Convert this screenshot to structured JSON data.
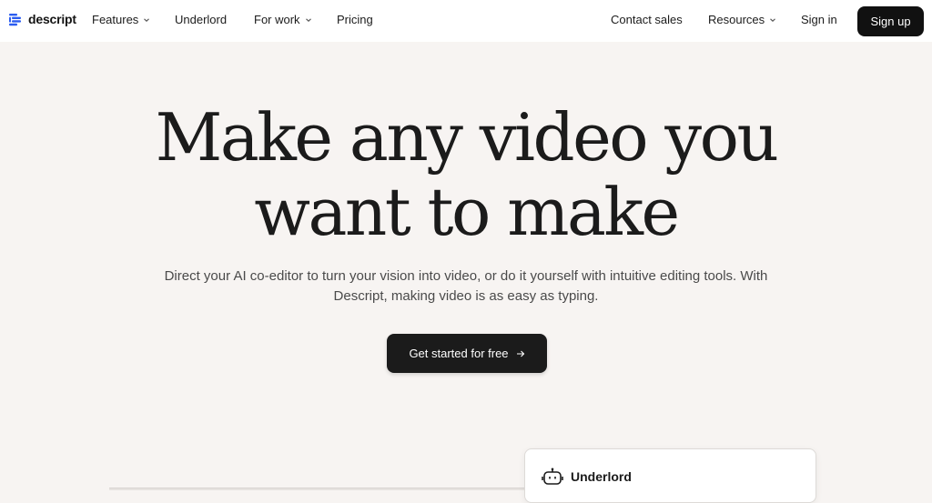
{
  "brand": {
    "name": "descript",
    "accent": "#2b5cf0"
  },
  "nav": {
    "left_items": [
      {
        "label": "Features",
        "has_dropdown": true
      },
      {
        "label": "Underlord",
        "has_dropdown": false
      },
      {
        "label": "For work",
        "has_dropdown": true
      },
      {
        "label": "Pricing",
        "has_dropdown": false
      }
    ],
    "right_items": [
      {
        "label": "Contact sales",
        "has_dropdown": false
      },
      {
        "label": "Resources",
        "has_dropdown": true
      },
      {
        "label": "Sign in",
        "has_dropdown": false
      }
    ],
    "signup_label": "Sign up"
  },
  "hero": {
    "title_line1": "Make any video you",
    "title_line2": "want to make",
    "subtitle_line1": "Direct your AI co-editor to turn your vision into video, or do it yourself with intuitive editing tools. With",
    "subtitle_line2": "Descript, making video is as easy as typing.",
    "cta_label": "Get started for free",
    "cta_icon": "arrow-right-icon"
  },
  "panel": {
    "icon": "robot-icon",
    "title": "Underlord"
  }
}
